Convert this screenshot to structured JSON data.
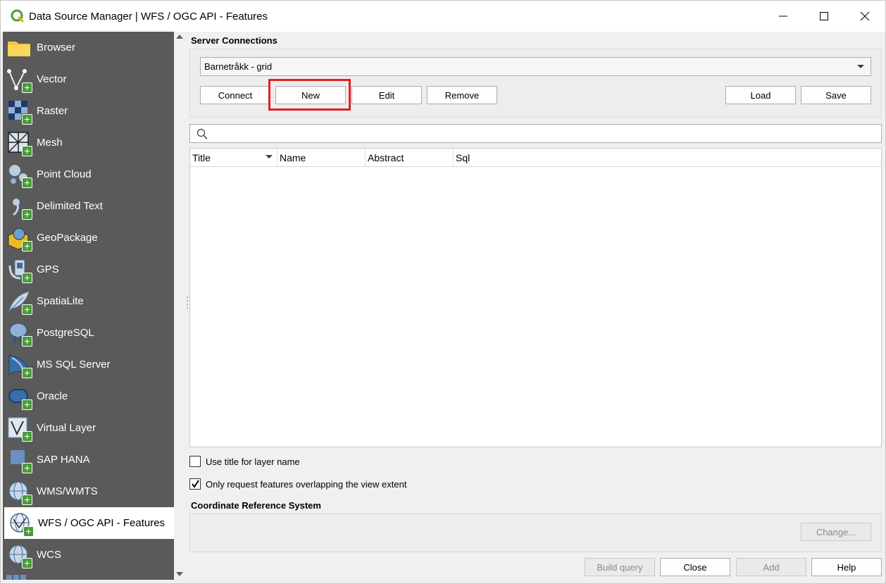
{
  "window": {
    "title": "Data Source Manager | WFS / OGC API - Features"
  },
  "sidebar": {
    "items": [
      {
        "label": "Browser",
        "icon": "folder-icon"
      },
      {
        "label": "Vector",
        "icon": "vector-icon"
      },
      {
        "label": "Raster",
        "icon": "raster-icon"
      },
      {
        "label": "Mesh",
        "icon": "mesh-icon"
      },
      {
        "label": "Point Cloud",
        "icon": "point-cloud-icon"
      },
      {
        "label": "Delimited Text",
        "icon": "comma-icon"
      },
      {
        "label": "GeoPackage",
        "icon": "geopackage-icon"
      },
      {
        "label": "GPS",
        "icon": "gps-icon"
      },
      {
        "label": "SpatiaLite",
        "icon": "feather-icon"
      },
      {
        "label": "PostgreSQL",
        "icon": "elephant-icon"
      },
      {
        "label": "MS SQL Server",
        "icon": "mssql-icon"
      },
      {
        "label": "Oracle",
        "icon": "oracle-icon"
      },
      {
        "label": "Virtual Layer",
        "icon": "virtual-layer-icon"
      },
      {
        "label": "SAP HANA",
        "icon": "sap-hana-icon"
      },
      {
        "label": "WMS/WMTS",
        "icon": "wms-globe-icon"
      },
      {
        "label": "WFS / OGC API - Features",
        "icon": "wfs-globe-icon"
      },
      {
        "label": "WCS",
        "icon": "wcs-globe-icon"
      }
    ],
    "selected": "WFS / OGC API - Features"
  },
  "server_connections": {
    "label": "Server Connections",
    "selected_connection": "Barnetråkk - grid",
    "buttons": {
      "connect": "Connect",
      "new": "New",
      "edit": "Edit",
      "remove": "Remove",
      "load": "Load",
      "save": "Save"
    }
  },
  "search": {
    "placeholder": ""
  },
  "table": {
    "columns": [
      "Title",
      "Name",
      "Abstract",
      "Sql"
    ],
    "rows": []
  },
  "options": {
    "use_title": {
      "label": "Use title for layer name",
      "checked": false
    },
    "only_request": {
      "label": "Only request features overlapping the view extent",
      "checked": true
    }
  },
  "crs": {
    "label": "Coordinate Reference System",
    "change_button": "Change..."
  },
  "footer": {
    "build_query": "Build query",
    "close": "Close",
    "add": "Add",
    "help": "Help"
  },
  "colors": {
    "sidebar_bg": "#5a5a5a",
    "highlight": "#e02020",
    "plus_badge": "#4a9a3a"
  }
}
